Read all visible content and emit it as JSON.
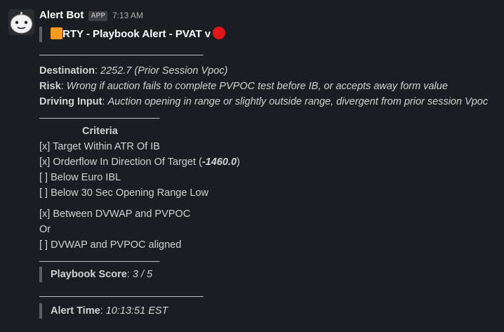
{
  "message": {
    "bot_name": "Alert Bot",
    "app_badge": "APP",
    "timestamp": "7:13 AM",
    "avatar_icon": "robot-face-icon"
  },
  "alert": {
    "title": "RTY - Playbook Alert - PVAT v",
    "title_emoji_left": "orange-square-icon",
    "title_emoji_right": "red-circle-icon",
    "divider_long": "______________________________",
    "divider_short": "______________________",
    "destination_label": "Destination",
    "destination_value": "2252.7 (Prior Session Vpoc)",
    "risk_label": "Risk",
    "risk_value": "Wrong if auction fails to complete PVPOC test before IB, or accepts away form value",
    "driving_label": "Driving Input",
    "driving_value": "Auction opening in range or slightly outside range, divergent from prior session Vpoc",
    "criteria_title": "Criteria",
    "criteria": [
      {
        "mark": "[x]",
        "text": "Target Within ATR Of IB"
      },
      {
        "mark": "[x]",
        "text": "Orderflow In Direction Of Target (",
        "value": "-1460.0",
        "suffix": ")"
      },
      {
        "mark": "[ ]",
        "text": "Below Euro IBL"
      },
      {
        "mark": "[ ]",
        "text": "Below 30 Sec Opening Range Low"
      }
    ],
    "criteria_extra": [
      {
        "mark": "[x]",
        "text": "Between DVWAP and PVPOC"
      },
      {
        "mark": "",
        "text": "Or"
      },
      {
        "mark": "[ ]",
        "text": "DVWAP and PVPOC aligned"
      }
    ],
    "score_label": "Playbook Score",
    "score_value": "3 / 5",
    "alert_time_label": "Alert Time",
    "alert_time_value": "10:13:51 EST"
  },
  "colors": {
    "background": "#1a1d21",
    "text": "#d1d2d3",
    "quote_bar": "#5e5f63",
    "orange_square": "#f59a1d",
    "red_circle": "#e0161b"
  }
}
